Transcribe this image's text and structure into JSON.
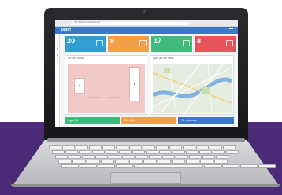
{
  "browser": {
    "url": "http://www.example.com/"
  },
  "app": {
    "title": "iaddf"
  },
  "stats": [
    {
      "value": "20",
      "label": "",
      "color": "#2f9fd3"
    },
    {
      "value": "8",
      "label": "",
      "color": "#f0a04b"
    },
    {
      "value": "17",
      "label": "",
      "color": "#3dbb7a"
    },
    {
      "value": "8",
      "label": "",
      "color": "#e4545a"
    }
  ],
  "panels": {
    "left_title": "Uu Sno al Stn",
    "right_title": "Spor ast Bo Olsin"
  },
  "footer_buttons": [
    {
      "label": "Sqpe Sli",
      "color": "#3dbb7a"
    },
    {
      "label": "Snp Sne",
      "color": "#f0a04b"
    },
    {
      "label": "Gle gdomase",
      "color": "#3a78c9"
    }
  ],
  "colors": {
    "accent": "#3a78c9",
    "band": "#4b2a78"
  }
}
